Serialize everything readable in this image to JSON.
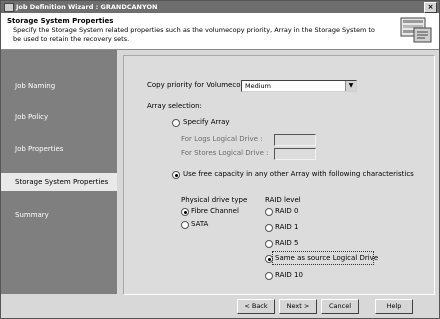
{
  "window": {
    "title": "Job Definition Wizard : GRANDCANYON",
    "close_glyph": "×"
  },
  "header": {
    "title": "Storage System Properties",
    "description": "Specify the Storage System related properties such as the volumecopy priority, Array in the Storage System to be used to retain the recovery sets."
  },
  "sidebar": {
    "items": [
      {
        "label": "Job Naming",
        "selected": false
      },
      {
        "label": "Job Policy",
        "selected": false
      },
      {
        "label": "Job Properties",
        "selected": false
      },
      {
        "label": "Storage System Properties",
        "selected": true
      },
      {
        "label": "Summary",
        "selected": false
      }
    ]
  },
  "form": {
    "copy_priority_label": "Copy priority for Volumecopy:",
    "copy_priority_value": "Medium",
    "array_selection_label": "Array selection:",
    "specify_array_label": "Specify Array",
    "logs_drive_label": "For Logs Logical Drive :",
    "stores_drive_label": "For Stores Logical Drive :",
    "use_free_capacity_label": "Use free capacity in any other Array with following characteristics",
    "physical_drive_type_label": "Physical drive type",
    "drive_types": [
      "Fibre Channel",
      "SATA"
    ],
    "selected_drive_type": "Fibre Channel",
    "raid_level_label": "RAID level",
    "raid_levels": [
      "RAID 0",
      "RAID 1",
      "RAID 5",
      "Same as source Logical Drive",
      "RAID 10"
    ],
    "selected_raid_level": "Same as source Logical Drive"
  },
  "buttons": {
    "back": "< Back",
    "next": "Next >",
    "cancel": "Cancel",
    "help": "Help"
  },
  "colors": {
    "titlebar": "#6e6e6e",
    "sidebar": "#7f7f7f",
    "panel": "#dcdcdc"
  }
}
